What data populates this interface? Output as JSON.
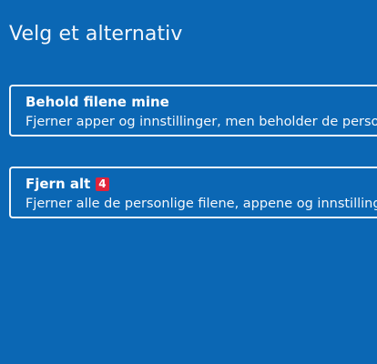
{
  "page": {
    "title": "Velg et alternativ"
  },
  "options": [
    {
      "title": "Behold filene mine",
      "description": "Fjerner apper og innstillinger, men beholder de personlige filene dine."
    },
    {
      "title": "Fjern alt",
      "badge": "4",
      "description": "Fjerner alle de personlige filene, appene og innstillingene dine."
    }
  ],
  "colors": {
    "background": "#0b67b4",
    "border": "#f1f5fa",
    "badge": "#e0233b"
  }
}
